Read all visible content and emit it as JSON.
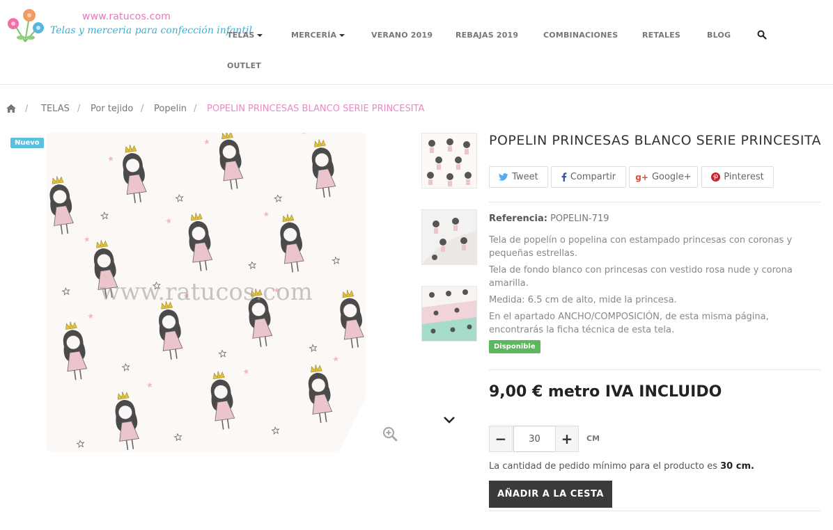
{
  "logo": {
    "url_text": "www.ratucos.com",
    "tagline": "Telas y merceria para confección infantil"
  },
  "nav": {
    "row1": [
      {
        "label": "TELAS",
        "has_dropdown": true
      },
      {
        "label": "MERCERÍA",
        "has_dropdown": true
      },
      {
        "label": "VERANO 2019",
        "has_dropdown": false
      },
      {
        "label": "REBAJAS 2019",
        "has_dropdown": false
      },
      {
        "label": "COMBINACIONES",
        "has_dropdown": false
      },
      {
        "label": "RETALES",
        "has_dropdown": false
      },
      {
        "label": "BLOG",
        "has_dropdown": false
      }
    ],
    "row2": [
      {
        "label": "OUTLET"
      }
    ],
    "search_icon": "search-icon"
  },
  "breadcrumb": {
    "home_icon": "home-icon",
    "separator": "/",
    "items": [
      "TELAS",
      "Por tejido",
      "Popelin"
    ],
    "current": "POPELIN PRINCESAS BLANCO SERIE PRINCESITA"
  },
  "gallery": {
    "badge": "Nuevo",
    "watermark": "www.ratucos.com",
    "zoom_icon": "zoom-in-icon",
    "next_icon": "chevron-down-icon"
  },
  "product": {
    "title": "POPELIN PRINCESAS BLANCO SERIE PRINCESITA",
    "share": {
      "tweet": "Tweet",
      "facebook": "Compartir",
      "google": "Google+",
      "pinterest": "Pinterest"
    },
    "reference_label": "Referencia:",
    "reference_value": "POPELIN-719",
    "description": [
      "Tela de popelín o popelina con estampado princesas con coronas y pequeñas estrellas.",
      "Tela de fondo blanco con princesas con vestido rosa nude y corona amarilla.",
      "Medida: 6.5 cm de alto, mide la princesa.",
      "En el apartado ANCHO/COMPOSICIÓN, de esta misma página, encontrarás la ficha técnica de esta tela."
    ],
    "availability": "Disponible",
    "price": "9,00 € metro IVA INCLUIDO",
    "quantity": {
      "minus": "−",
      "value": "30",
      "plus": "+",
      "unit": "CM"
    },
    "minimum_text": "La cantidad de pedido mínimo para el producto es",
    "minimum_value": "30 cm.",
    "cart_button": "AÑADIR A LA CESTA"
  },
  "colors": {
    "accent_pink": "#e68cc4",
    "badge_blue": "#5bc0de",
    "available_green": "#5cb85c",
    "cart_dark": "#3a3a3a"
  }
}
